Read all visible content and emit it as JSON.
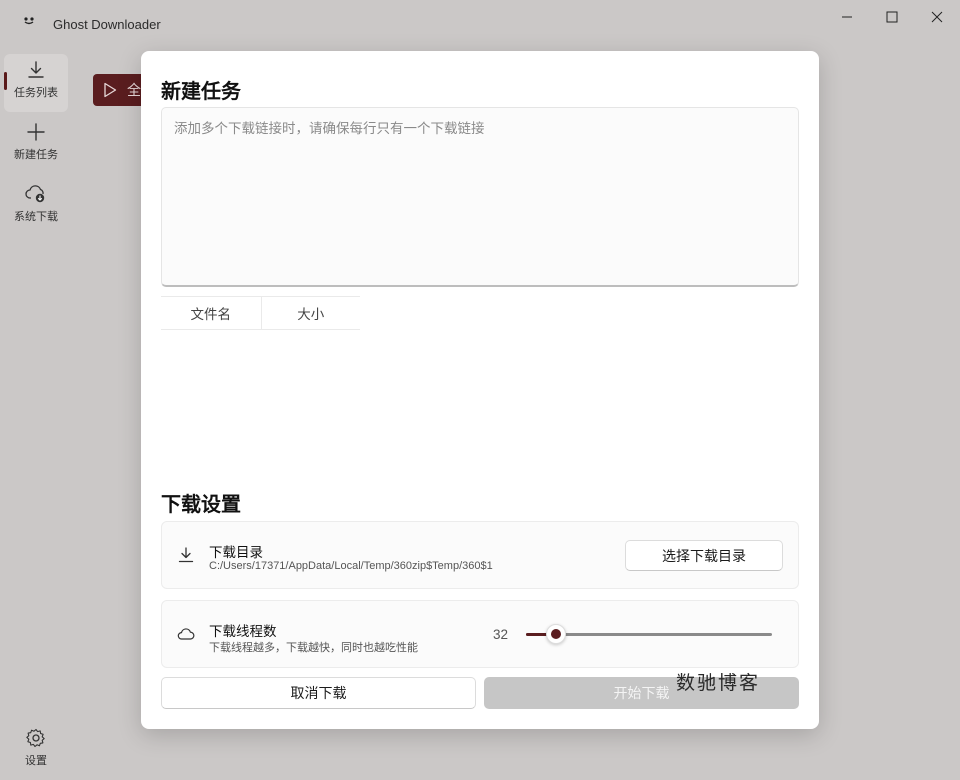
{
  "window": {
    "title": "Ghost Downloader"
  },
  "sidebar": {
    "items": [
      {
        "label": "任务列表",
        "icon": "download-icon"
      },
      {
        "label": "新建任务",
        "icon": "plus-icon"
      },
      {
        "label": "系统下载",
        "icon": "cloud-download-icon"
      }
    ],
    "settings_label": "设置"
  },
  "background": {
    "start_all_label": "全"
  },
  "dialog": {
    "title": "新建任务",
    "links_placeholder": "添加多个下载链接时，请确保每行只有一个下载链接",
    "table_headers": [
      "文件名",
      "大小"
    ],
    "settings_title": "下载设置",
    "directory": {
      "title": "下载目录",
      "path": "C:/Users/17371/AppData/Local/Temp/360zip$Temp/360$1",
      "button": "选择下载目录"
    },
    "threads": {
      "title": "下载线程数",
      "description": "下载线程越多，下载越快，同时也越吃性能",
      "value": "32",
      "slider_fraction": 0.12
    },
    "cancel_label": "取消下载",
    "start_label": "开始下载"
  },
  "watermark": "数驰博客",
  "colors": {
    "accent": "#5a1d1f",
    "dialog_bg": "#ffffff",
    "window_bg": "#cbc8c7"
  }
}
